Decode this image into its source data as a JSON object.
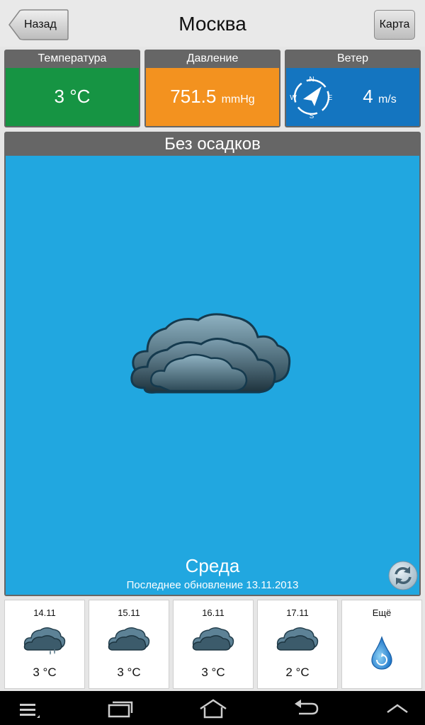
{
  "header": {
    "back_label": "Назад",
    "title": "Москва",
    "map_label": "Карта"
  },
  "cards": {
    "temperature": {
      "caption": "Температура",
      "value": "3",
      "unit": "°C",
      "color": "#169443"
    },
    "pressure": {
      "caption": "Давление",
      "value": "751.5",
      "unit": "mmHg",
      "color": "#f3921f"
    },
    "wind": {
      "caption": "Ветер",
      "value": "4",
      "unit": "m/s",
      "color": "#1475c0",
      "compass": {
        "n": "N",
        "e": "E",
        "s": "S",
        "w": "W"
      }
    }
  },
  "current": {
    "condition": "Без осадков",
    "day": "Среда",
    "updated": "Последнее обновление 13.11.2013",
    "sky_color": "#21a7e0",
    "icon": "cloud-icon"
  },
  "forecast": [
    {
      "date": "14.11",
      "temp": "3 °C",
      "icon": "cloud-rain-icon"
    },
    {
      "date": "15.11",
      "temp": "3 °C",
      "icon": "cloud-icon"
    },
    {
      "date": "16.11",
      "temp": "3 °C",
      "icon": "cloud-icon"
    },
    {
      "date": "17.11",
      "temp": "2 °C",
      "icon": "cloud-icon"
    }
  ],
  "more": {
    "label": "Ещё",
    "icon": "water-drop-icon"
  },
  "navbar": {
    "icons": [
      "menu-icon",
      "recent-apps-icon",
      "home-icon",
      "back-icon",
      "chevron-up-icon"
    ]
  }
}
